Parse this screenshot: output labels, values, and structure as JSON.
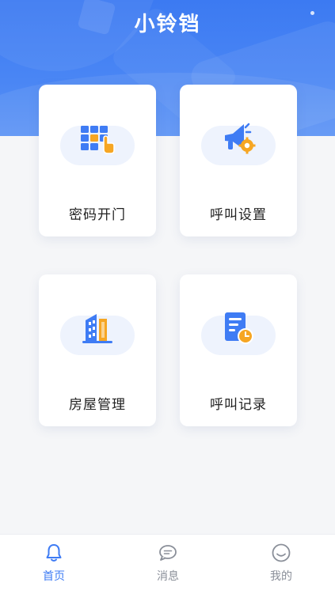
{
  "header": {
    "title": "小铃铛"
  },
  "cards": [
    {
      "label": "密码开门",
      "icon": "keypad-icon"
    },
    {
      "label": "呼叫设置",
      "icon": "megaphone-settings-icon"
    },
    {
      "label": "房屋管理",
      "icon": "building-icon"
    },
    {
      "label": "呼叫记录",
      "icon": "document-clock-icon"
    }
  ],
  "tabbar": {
    "items": [
      {
        "label": "首页",
        "icon": "bell-icon",
        "active": true
      },
      {
        "label": "消息",
        "icon": "chat-bubble-icon",
        "active": false
      },
      {
        "label": "我的",
        "icon": "smiley-face-icon",
        "active": false
      }
    ]
  },
  "colors": {
    "primary": "#3f7cf4",
    "accent": "#f6a623",
    "header_bg": "#3c7af2",
    "inactive": "#8a8f99"
  }
}
